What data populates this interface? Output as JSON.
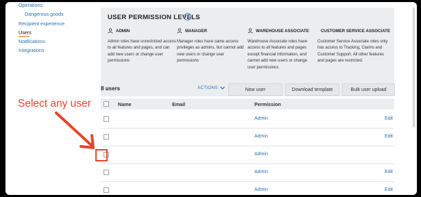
{
  "sidebar": {
    "items": [
      {
        "label": "Operations",
        "level": 1
      },
      {
        "label": "Dangerous goods",
        "level": 2
      },
      {
        "label": "Recipient experience",
        "level": 1
      },
      {
        "label": "Users",
        "level": 1,
        "active": true
      },
      {
        "label": "Notifications",
        "level": 1
      },
      {
        "label": "Integrations",
        "level": 1
      }
    ]
  },
  "permission_panel": {
    "title": "USER PERMISSION LEVELS",
    "roles": [
      {
        "name": "ADMIN",
        "icon": "person-icon",
        "description": "Admin roles have unrestricted access to all features and pages, and can add new users or change user permissions"
      },
      {
        "name": "MANAGER",
        "icon": "person-icon",
        "description": "Manager roles have same access privileges as admins, but cannot add new users or change user permissions"
      },
      {
        "name": "WAREHOUSE ASSOCIATE",
        "icon": "person-icon",
        "description": "Warehouse Associate roles have access to all features and pages except financial information, and cannot add new users or change user permissions"
      },
      {
        "name": "CUSTOMER SERVICE ASSOCIATE",
        "icon": "person-icon",
        "description": "Customer Service Associate roles only has access to Tracking, Claims and Customer Support. All other features and pages are restricted."
      }
    ]
  },
  "toolbar": {
    "user_count": "8 users",
    "actions_label": "ACTIONS",
    "new_user": "New user",
    "download_template": "Download template",
    "bulk_upload": "Bulk user upload"
  },
  "table": {
    "headers": {
      "name": "Name",
      "email": "Email",
      "permission": "Permission"
    },
    "rows": [
      {
        "name": "",
        "email": "",
        "permission": "Admin",
        "action": "Edit"
      },
      {
        "name": "",
        "email": "",
        "permission": "Admin",
        "action": "Edit"
      },
      {
        "name": "",
        "email": "",
        "permission": "Admin",
        "action": ""
      },
      {
        "name": "",
        "email": "",
        "permission": "Admin",
        "action": "Edit"
      },
      {
        "name": "",
        "email": "",
        "permission": "Admin",
        "action": "Edit"
      }
    ]
  },
  "annotation": {
    "text": "Select any user",
    "color": "#e8442e"
  },
  "colors": {
    "link": "#2a6fb0",
    "accent": "#e47911",
    "panel_bg": "#ebedee"
  }
}
